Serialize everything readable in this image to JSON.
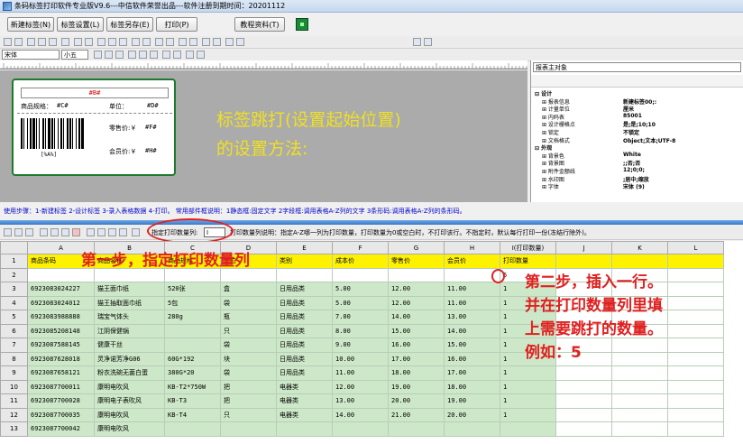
{
  "window": {
    "title": "条码标签打印软件专业版V9.6---中信软件荣誉出品---软件注册到期时间：20201112"
  },
  "buttons": [
    {
      "label": "新建标签(N)"
    },
    {
      "label": "标签设置(L)"
    },
    {
      "label": "标签另存(E)"
    },
    {
      "label": "打印(P)"
    },
    {
      "label": "教程资料(T)"
    }
  ],
  "format_toolbar": {
    "font": "宋体",
    "size": "小五"
  },
  "label_preview": {
    "top_field": "#B#",
    "name_label": "商品规格：",
    "name_value": "#C#",
    "unit_label": "单位：",
    "unit_value": "#D#",
    "retail_label": "零售价:￥",
    "retail_value": "#F#",
    "member_label": "会员价:￥",
    "member_value": "#H#",
    "barcode_text": "[%A%]"
  },
  "instruction": {
    "line1": "标签跳打(设置起始位置)",
    "line2": "的设置方法:"
  },
  "properties": {
    "object_selector": "报表主对象",
    "rows": [
      {
        "key": "设计",
        "value": "",
        "category": true
      },
      {
        "key": "报表信息",
        "value": "新建标签00;:",
        "category": false
      },
      {
        "key": "计量单位",
        "value": "厘米",
        "category": false
      },
      {
        "key": "内码表",
        "value": "85001",
        "category": false
      },
      {
        "key": "设计栅格点",
        "value": "是;是;10;10",
        "category": false
      },
      {
        "key": "锁定",
        "value": "不锁定",
        "category": false
      },
      {
        "key": "文档格式",
        "value": "Object;文本;UTF-8",
        "category": false
      },
      {
        "key": "外观",
        "value": "",
        "category": true
      },
      {
        "key": "背景色",
        "value": "White",
        "category": false
      },
      {
        "key": "背景图",
        "value": ";;否;否",
        "category": false
      },
      {
        "key": "附件金额线",
        "value": "12;0;0;",
        "category": false
      },
      {
        "key": "水印图",
        "value": ";居中;缩放",
        "category": false
      },
      {
        "key": "字体",
        "value": "宋体 (9)",
        "category": false
      }
    ]
  },
  "status_text": "使用步骤：1-新建标签 2-设计标签 3-录入表格数据 4-打印。 常用部件框说明：1静态框:固定文字 2字段框:调用表格A-Z列的文字 3条形码:调用表格A-Z列的条形码。",
  "grid_toolbar": {
    "qty_label": "指定打印数量列:",
    "qty_value": "I",
    "hint": "打印数量列说明：指定A-Z哪一列为打印数量，打印数量为0或空白时，不打印该行。不指定时，默认每行打印一份(冻结行除外)。"
  },
  "sheet": {
    "col_letters": [
      "A",
      "B",
      "C",
      "D",
      "E",
      "F",
      "G",
      "H",
      "I(打印数量)",
      "J",
      "K",
      "L"
    ],
    "row_numbers": [
      "1",
      "2",
      "3",
      "4",
      "5",
      "6",
      "7",
      "8",
      "9",
      "10",
      "11",
      "12",
      "13"
    ],
    "field_headers": [
      "商品条码",
      "商品名称",
      "商品规格",
      "单位",
      "类别",
      "成本价",
      "零售价",
      "会员价",
      "打印数量",
      "",
      "",
      ""
    ],
    "rows": [
      [
        "",
        "",
        "",
        "",
        "",
        "",
        "",
        "",
        "5",
        "",
        "",
        ""
      ],
      [
        "6923083024227",
        "猫王面巾纸",
        "520张",
        "盒",
        "日用品类",
        "5.00",
        "12.00",
        "11.00",
        "1",
        "",
        "",
        ""
      ],
      [
        "6923083024012",
        "猫王抽取面巾纸",
        "5包",
        "袋",
        "日用品类",
        "5.00",
        "12.00",
        "11.00",
        "1",
        "",
        "",
        ""
      ],
      [
        "6923083988888",
        "瑞宝气体头",
        "280g",
        "瓶",
        "日用品类",
        "7.00",
        "14.00",
        "13.00",
        "1",
        "",
        "",
        ""
      ],
      [
        "6923085208148",
        "江阴保健锅",
        "",
        "只",
        "日用品类",
        "8.00",
        "15.00",
        "14.00",
        "1",
        "",
        "",
        ""
      ],
      [
        "6923087588145",
        "健康干丝",
        "",
        "袋",
        "日用品类",
        "9.00",
        "16.00",
        "15.00",
        "1",
        "",
        "",
        ""
      ],
      [
        "6923087628018",
        "灵净诺芳净G06",
        "60G*192",
        "块",
        "日用品类",
        "10.00",
        "17.00",
        "16.00",
        "1",
        "",
        "",
        ""
      ],
      [
        "6923087658121",
        "粉衣洗碗无菌白蛋",
        "380G*20",
        "袋",
        "日用品类",
        "11.00",
        "18.00",
        "17.00",
        "1",
        "",
        "",
        ""
      ],
      [
        "6923087700011",
        "康明电吹风",
        "KB-T2*750W",
        "把",
        "电器类",
        "12.00",
        "19.00",
        "18.00",
        "1",
        "",
        "",
        ""
      ],
      [
        "6923087700028",
        "康明电子表吹风",
        "KB-T3",
        "把",
        "电器类",
        "13.00",
        "20.00",
        "19.00",
        "1",
        "",
        "",
        ""
      ],
      [
        "6923087700035",
        "康明电吹风",
        "KB-T4",
        "只",
        "电器类",
        "14.00",
        "21.00",
        "20.00",
        "1",
        "",
        "",
        ""
      ],
      [
        "6923087700042",
        "康明电吹风",
        "",
        "",
        "",
        "",
        "",
        "",
        "",
        "",
        "",
        ""
      ]
    ]
  },
  "annotations": {
    "step1": "第一步，指定打印数量列",
    "step2": [
      "第二步，插入一行。",
      "并在打印数量列里填",
      "上需要跳打的数量。",
      "例如：5"
    ]
  }
}
